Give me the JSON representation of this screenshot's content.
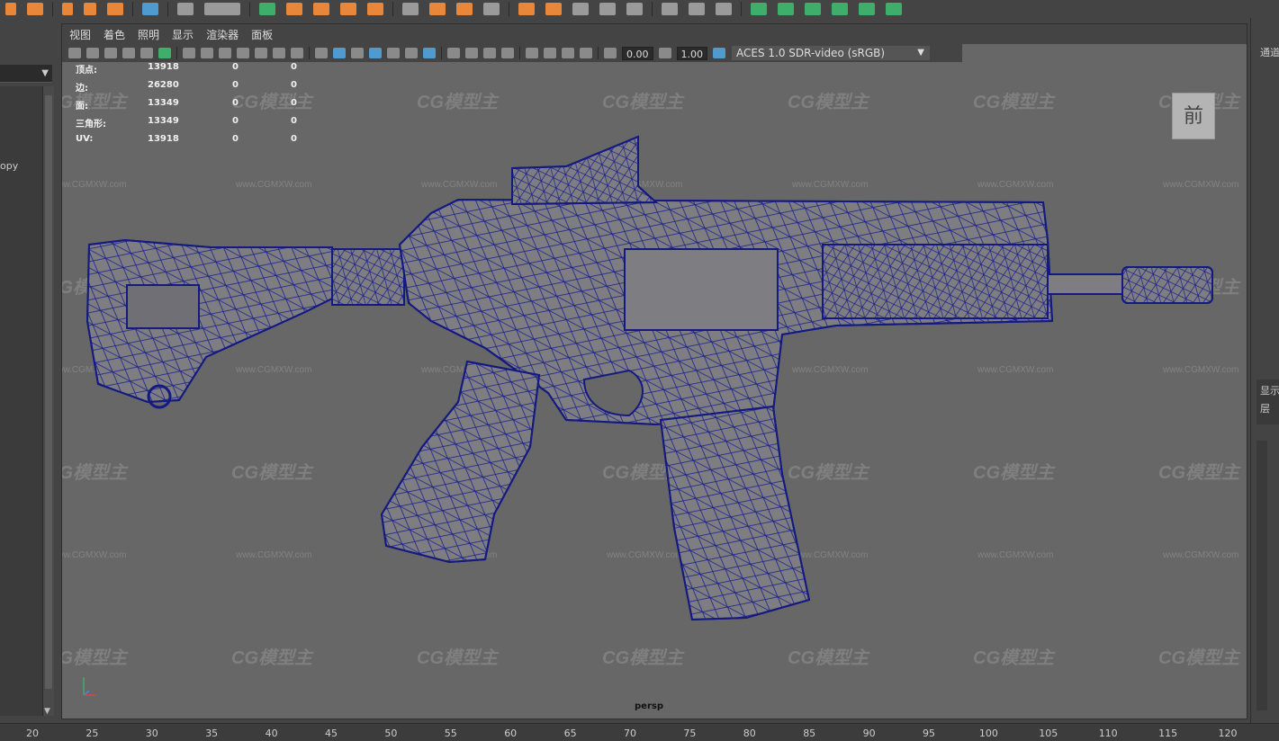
{
  "viewport": {
    "menu": [
      "视图",
      "着色",
      "照明",
      "显示",
      "渲染器",
      "面板"
    ],
    "toolbar": {
      "field_a": "0.00",
      "field_b": "1.00",
      "colorspace": "ACES 1.0 SDR-video (sRGB)"
    },
    "hud": [
      {
        "label": "顶点:",
        "v1": "13918",
        "v2": "0",
        "v3": "0"
      },
      {
        "label": "边:",
        "v1": "26280",
        "v2": "0",
        "v3": "0"
      },
      {
        "label": "面:",
        "v1": "13349",
        "v2": "0",
        "v3": "0"
      },
      {
        "label": "三角形:",
        "v1": "13349",
        "v2": "0",
        "v3": "0"
      },
      {
        "label": "UV:",
        "v1": "13918",
        "v2": "0",
        "v3": "0"
      }
    ],
    "camera_label": "persp",
    "view_cube_label": "前",
    "watermark_logo": "CG模型主",
    "watermark_url": "www.CGMXW.com"
  },
  "left_panel": {
    "item": "opy"
  },
  "right_panel": {
    "label_top": "通道",
    "label_display": "显示",
    "label_layer": "层"
  },
  "timeline": {
    "ticks": [
      "20",
      "25",
      "30",
      "35",
      "40",
      "45",
      "50",
      "55",
      "60",
      "65",
      "70",
      "75",
      "80",
      "85",
      "90",
      "95",
      "100",
      "105",
      "110",
      "115",
      "120"
    ]
  },
  "colors": {
    "viewport_bg": "#676767",
    "wire": "#1a1f8a",
    "mesh": "#7b7b80",
    "ui_dark": "#444444",
    "accent_orange": "#e8873a",
    "accent_green": "#3fae6a"
  },
  "icons": {
    "shelf": [
      "sphere-icon",
      "move-icon",
      "scale-icon",
      "rotate-icon",
      "cube-icon",
      "grid-icon",
      "camera-icon",
      "xform-icon",
      "curve-icon",
      "deform-icon",
      "render-icon",
      "light-icon",
      "uv-icon",
      "sculpt-icon"
    ]
  }
}
